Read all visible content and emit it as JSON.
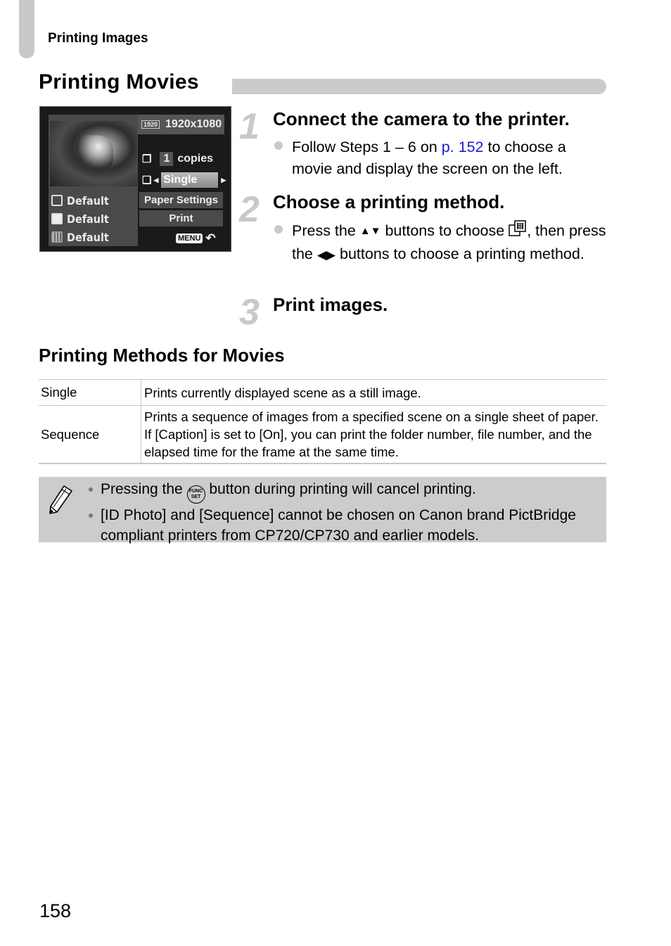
{
  "header": {
    "running_title": "Printing Images"
  },
  "section": {
    "title": "Printing Movies"
  },
  "camera_screen": {
    "resolution_badge": "1920",
    "resolution": "1920x1080",
    "copies_value": "1",
    "copies_label": "copies",
    "method_selected": "Single",
    "settings": [
      {
        "icon": "paper-size-icon",
        "value": "Default"
      },
      {
        "icon": "paper-type-icon",
        "value": "Default"
      },
      {
        "icon": "layout-icon",
        "value": "Default"
      }
    ],
    "paper_settings_label": "Paper Settings",
    "print_label": "Print",
    "menu_label": "MENU",
    "back_glyph": "⮌"
  },
  "steps": [
    {
      "number": "1",
      "title": "Connect the camera to the printer.",
      "text_before_link": "Follow Steps 1 – 6 on ",
      "link": "p. 152",
      "text_after_link": " to choose a movie and display the screen on the left."
    },
    {
      "number": "2",
      "title": "Choose a printing method.",
      "text_1": "Press the ",
      "up_down_glyph": "▲▼",
      "text_2": " buttons to choose ",
      "text_3": ", then press the ",
      "left_right_glyph": "◀▶",
      "text_4": " buttons to choose a printing method."
    },
    {
      "number": "3",
      "title": "Print images."
    }
  ],
  "methods": {
    "title": "Printing Methods for Movies",
    "rows": [
      {
        "name": "Single",
        "description": "Prints currently displayed scene as a still image."
      },
      {
        "name": "Sequence",
        "description": "Prints a sequence of images from a specified scene on a single sheet of paper. If [Caption] is set to [On], you can print the folder number, file number, and the elapsed time for the frame at the same time."
      }
    ]
  },
  "note": {
    "item1_before": "Pressing the ",
    "func_top": "FUNC",
    "func_bottom": "SET",
    "item1_after": " button during printing will cancel printing.",
    "item2": "[ID Photo] and [Sequence] cannot be chosen on Canon brand PictBridge compliant printers from CP720/CP730 and earlier models."
  },
  "page_number": "158"
}
